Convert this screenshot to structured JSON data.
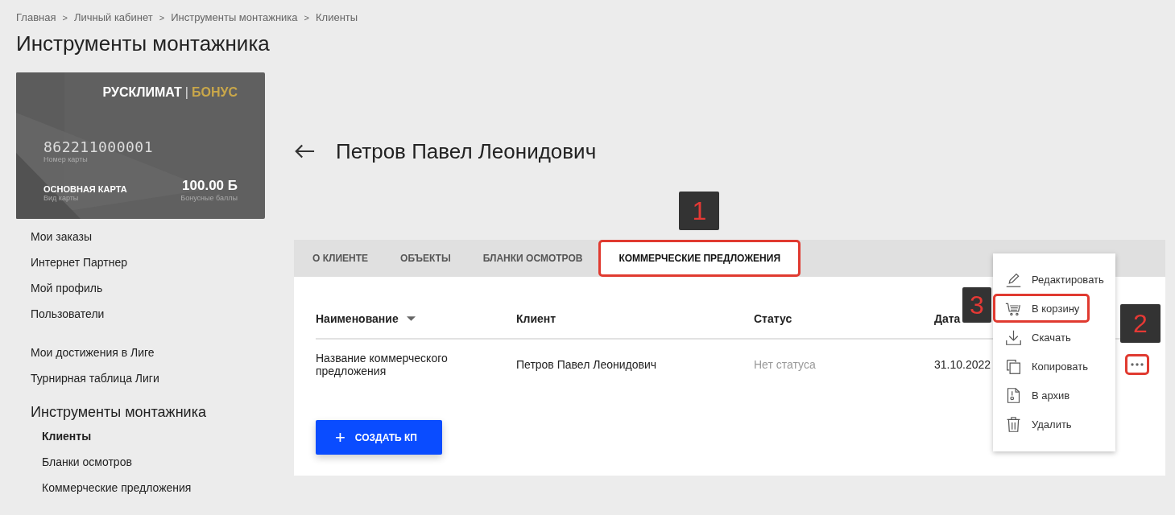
{
  "breadcrumbs": [
    "Главная",
    "Личный кабинет",
    "Инструменты монтажника",
    "Клиенты"
  ],
  "breadcrumb_separator": ">",
  "page_title": "Инструменты монтажника",
  "bonus_card": {
    "brand": "РУСКЛИМАТ",
    "separator": "|",
    "program": "БОНУС",
    "number": "862211000001",
    "number_label": "Номер карты",
    "card_type": "ОСНОВНАЯ КАРТА",
    "card_type_label": "Вид карты",
    "points": "100.00 Б",
    "points_label": "Бонусные баллы"
  },
  "nav_groups": [
    {
      "items": [
        {
          "label": "Мои заказы"
        },
        {
          "label": "Интернет Партнер"
        },
        {
          "label": "Мой профиль"
        },
        {
          "label": "Пользователи"
        }
      ]
    },
    {
      "items": [
        {
          "label": "Мои достижения в Лиге"
        },
        {
          "label": "Турнирная таблица Лиги"
        }
      ]
    }
  ],
  "tools_section": {
    "title": "Инструменты монтажника",
    "items": [
      {
        "label": "Клиенты",
        "selected": true
      },
      {
        "label": "Бланки осмотров",
        "selected": false
      },
      {
        "label": "Коммерческие предложения",
        "selected": false
      }
    ]
  },
  "client_name": "Петров Павел Леонидович",
  "tabs": [
    {
      "label": "О КЛИЕНТЕ",
      "selected": false,
      "highlighted": false
    },
    {
      "label": "ОБЪЕКТЫ",
      "selected": false,
      "highlighted": false
    },
    {
      "label": "БЛАНКИ ОСМОТРОВ",
      "selected": false,
      "highlighted": false
    },
    {
      "label": "КОММЕРЧЕСКИЕ ПРЕДЛОЖЕНИЯ",
      "selected": true,
      "highlighted": true,
      "marker": "1"
    }
  ],
  "table": {
    "columns": [
      {
        "label": "Наименование",
        "sorted": true
      },
      {
        "label": "Клиент",
        "sorted": false
      },
      {
        "label": "Статус",
        "sorted": false
      },
      {
        "label": "Дата",
        "sorted": false
      }
    ],
    "rows": [
      {
        "name": "Название коммерческого предложения",
        "client": "Петров Павел Леонидович",
        "status": "Нет статуса",
        "date": "31.10.2022",
        "actions_highlighted": true,
        "actions_marker": "2"
      }
    ]
  },
  "create_button": {
    "icon": "+",
    "label": "СОЗДАТЬ КП"
  },
  "row_menu": [
    {
      "label": "Редактировать",
      "highlighted": false
    },
    {
      "label": "В корзину",
      "highlighted": true,
      "marker": "3"
    },
    {
      "label": "Скачать",
      "highlighted": false
    },
    {
      "label": "Копировать",
      "highlighted": false
    },
    {
      "label": "В архив",
      "highlighted": false
    },
    {
      "label": "Удалить",
      "highlighted": false
    }
  ]
}
